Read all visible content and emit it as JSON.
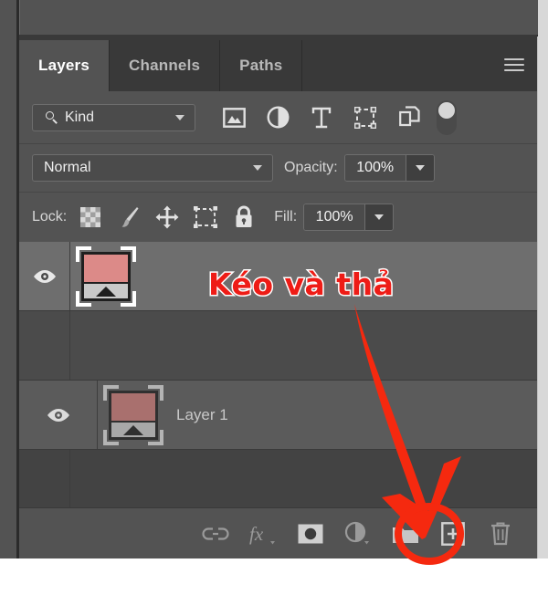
{
  "app": {
    "panel_title": "Layers",
    "accent_red": "#ee1c16",
    "panel_bg": "#535353",
    "list_bg": "#444444",
    "selected_row_bg": "#6e6e6e"
  },
  "tabs": [
    {
      "label": "Layers",
      "active": true
    },
    {
      "label": "Channels",
      "active": false
    },
    {
      "label": "Paths",
      "active": false
    }
  ],
  "panel_menu": {
    "icon": "hamburger-menu-icon"
  },
  "filter_row": {
    "kind_label": "Kind",
    "search_icon": "search-icon",
    "chevron_icon": "chevron-down-icon",
    "filter_icons": [
      {
        "name": "pixel-layer-filter-icon",
        "title": "Pixel layers"
      },
      {
        "name": "adjustment-layer-filter-icon",
        "title": "Adjustment layers"
      },
      {
        "name": "type-layer-filter-icon",
        "title": "Type layers"
      },
      {
        "name": "shape-layer-filter-icon",
        "title": "Shape layers"
      },
      {
        "name": "smart-object-filter-icon",
        "title": "Smart objects"
      }
    ],
    "toggle": {
      "name": "filter-enable-toggle",
      "state": "off"
    }
  },
  "blend_row": {
    "blend_mode": "Normal",
    "opacity_label": "Opacity:",
    "opacity_value": "100%"
  },
  "lock_row": {
    "lock_label": "Lock:",
    "lock_icons": [
      {
        "name": "lock-transparent-pixels-icon"
      },
      {
        "name": "lock-image-pixels-brush-icon"
      },
      {
        "name": "lock-position-move-icon"
      },
      {
        "name": "lock-artboard-nesting-icon"
      },
      {
        "name": "lock-all-padlock-icon"
      }
    ],
    "fill_label": "Fill:",
    "fill_value": "100%"
  },
  "layers": [
    {
      "name": "",
      "visible": true,
      "selected": true,
      "dragging": true,
      "thumb_color": "#dc8a88",
      "row_state": "selected"
    },
    {
      "name": "",
      "visible": false,
      "selected": false,
      "dragging": false,
      "thumb_color": "",
      "row_state": "dim"
    },
    {
      "name": "Layer 1",
      "visible": true,
      "selected": false,
      "dragging": false,
      "thumb_color": "#a9706e",
      "row_state": "drop-target"
    },
    {
      "name": "",
      "visible": false,
      "selected": false,
      "dragging": false,
      "thumb_color": "",
      "row_state": "dark"
    }
  ],
  "bottom_bar": {
    "buttons": [
      {
        "name": "link-layers-icon",
        "label": "Link layers"
      },
      {
        "name": "layer-style-fx-icon",
        "label": "fx"
      },
      {
        "name": "add-layer-mask-icon",
        "label": "Add layer mask"
      },
      {
        "name": "new-adjustment-layer-icon",
        "label": "New fill or adjustment layer"
      },
      {
        "name": "new-group-folder-icon",
        "label": "Create a new group"
      },
      {
        "name": "create-new-layer-icon",
        "label": "Create a new layer",
        "highlighted": true
      },
      {
        "name": "delete-layer-trash-icon",
        "label": "Delete layer"
      }
    ]
  },
  "annotations": {
    "callout_text": "Kéo và thả",
    "arrow": {
      "name": "drag-drop-arrow",
      "color": "#f5290f"
    },
    "highlight_circle": {
      "name": "new-layer-highlight-circle",
      "color": "#f5290f"
    }
  }
}
